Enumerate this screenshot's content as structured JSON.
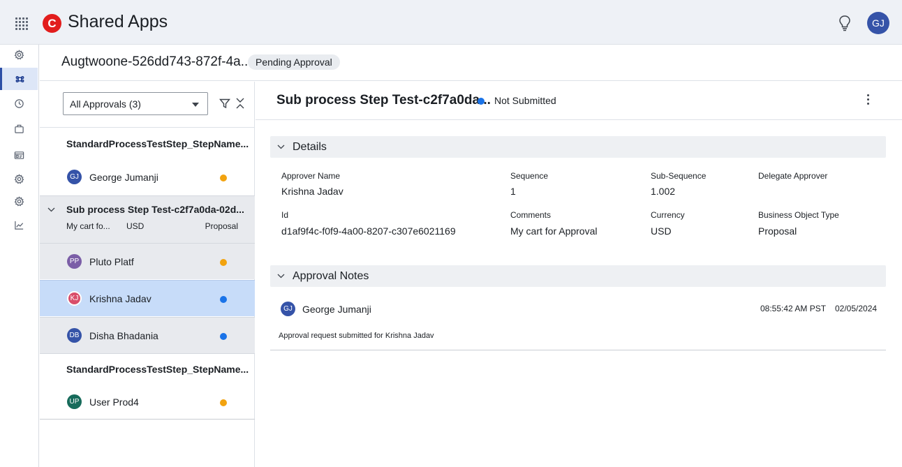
{
  "app": {
    "title": "Shared Apps",
    "logo_letter": "C",
    "user_initials": "GJ"
  },
  "icons": {
    "apps_grid": "apps-grid-icon",
    "bulb": "lightbulb-icon",
    "rail": [
      "gear-icon",
      "command-icon",
      "clock-icon",
      "briefcase-icon",
      "id-card-icon",
      "gear-icon",
      "gear-icon",
      "line-chart-icon"
    ]
  },
  "page": {
    "title": "Augtwoone-526dd743-872f-4a...",
    "status": "Pending Approval"
  },
  "list": {
    "filter": {
      "value": "All Approvals (3)"
    },
    "groups": [
      {
        "title": "StandardProcessTestStep_StepName...",
        "approvers": [
          {
            "initials": "GJ",
            "name": "George Jumanji",
            "status_color": "#f2a30f"
          }
        ]
      },
      {
        "title": "Sub process Step Test-c2f7a0da-02d...",
        "meta": {
          "comment": "My cart fo...",
          "currency": "USD",
          "type": "Proposal"
        },
        "approvers": [
          {
            "initials": "PP",
            "name": "Pluto Platf",
            "status_color": "#f2a30f",
            "avatar_color": "#7b5ea7"
          },
          {
            "initials": "KJ",
            "name": "Krishna Jadav",
            "status_color": "#1a73e8",
            "avatar_color": "#d94e6a"
          },
          {
            "initials": "DB",
            "name": "Disha Bhadania",
            "status_color": "#1a73e8",
            "avatar_color": "#3553a8"
          }
        ]
      },
      {
        "title": "StandardProcessTestStep_StepName...",
        "approvers": [
          {
            "initials": "UP",
            "name": "User Prod4",
            "status_color": "#f2a30f",
            "avatar_color": "#176b5b"
          }
        ]
      }
    ]
  },
  "detail": {
    "title": "Sub process Step Test-c2f7a0da...",
    "status": "Not Submitted",
    "details_section": {
      "title": "Details",
      "fields": {
        "approver_name": {
          "label": "Approver Name",
          "value": "Krishna Jadav"
        },
        "sequence": {
          "label": "Sequence",
          "value": "1"
        },
        "sub_sequence": {
          "label": "Sub-Sequence",
          "value": "1.002"
        },
        "delegate": {
          "label": "Delegate Approver",
          "value": ""
        },
        "id": {
          "label": "Id",
          "value": "d1af9f4c-f0f9-4a00-8207-c307e6021169"
        },
        "comments": {
          "label": "Comments",
          "value": "My cart for Approval"
        },
        "currency": {
          "label": "Currency",
          "value": "USD"
        },
        "bo_type": {
          "label": "Business Object Type",
          "value": "Proposal"
        }
      }
    },
    "notes_section": {
      "title": "Approval Notes",
      "note": {
        "initials": "GJ",
        "author": "George Jumanji",
        "time": "08:55:42 AM PST",
        "date": "02/05/2024",
        "text": "Approval request submitted for Krishna Jadav"
      }
    }
  },
  "colors": {
    "accent": "#2d4fa6",
    "pending": "#f2a30f",
    "active": "#1a73e8",
    "brand": "#e21d1d",
    "selected_row": "#c7dcf9"
  }
}
